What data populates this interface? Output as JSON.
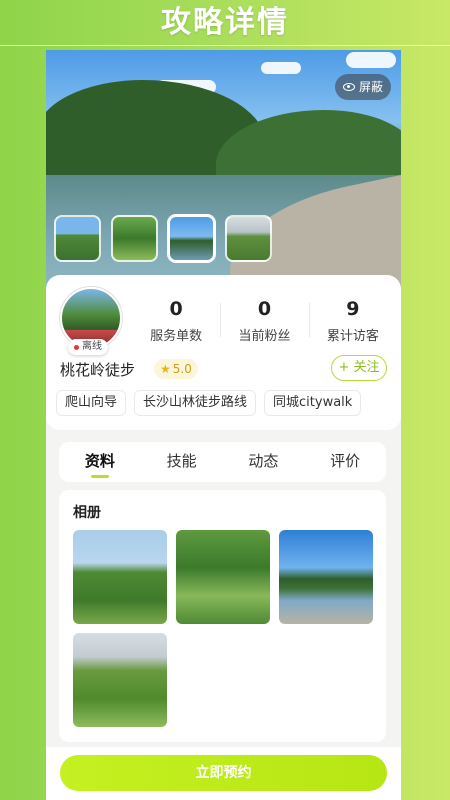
{
  "page_title": "攻略详情",
  "hero": {
    "hide_label": "屏蔽",
    "thumbnails": [
      "t1",
      "t2",
      "t3",
      "t4"
    ],
    "active_thumbnail": 2
  },
  "profile": {
    "status": "离线",
    "name": "桃花岭徒步",
    "rating": "5.0",
    "follow_label": "+ 关注",
    "stats": [
      {
        "value": "0",
        "label": "服务单数"
      },
      {
        "value": "0",
        "label": "当前粉丝"
      },
      {
        "value": "9",
        "label": "累计访客"
      }
    ],
    "tags": [
      "爬山向导",
      "长沙山林徒步路线",
      "同城citywalk"
    ]
  },
  "tabs": [
    {
      "label": "资料",
      "active": true
    },
    {
      "label": "技能",
      "active": false
    },
    {
      "label": "动态",
      "active": false
    },
    {
      "label": "评价",
      "active": false
    }
  ],
  "album": {
    "title": "相册",
    "photo_count": 4
  },
  "bottom": {
    "book_label": "立即预约"
  },
  "colors": {
    "accent": "#b6e613",
    "background": "#a6dd5a"
  }
}
